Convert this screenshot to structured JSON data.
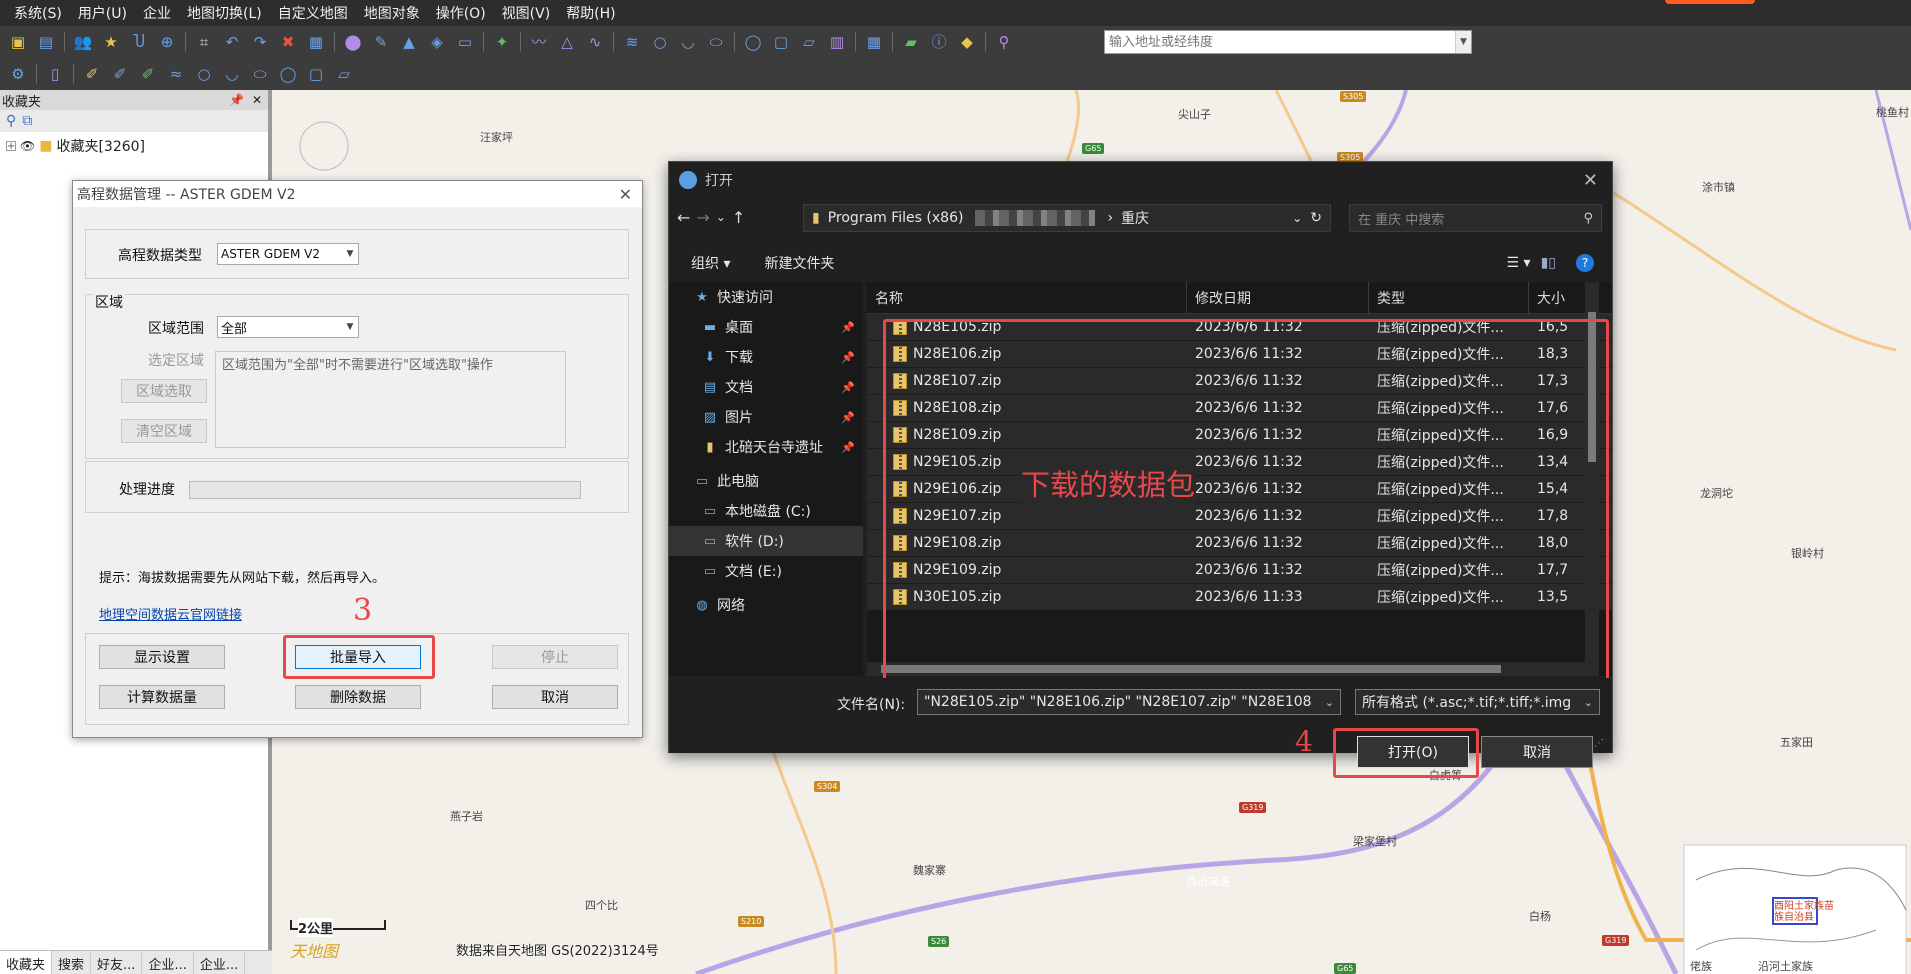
{
  "menu": [
    "系统(S)",
    "用户(U)",
    "企业",
    "地图切换(L)",
    "自定义地图",
    "地图对象",
    "操作(O)",
    "视图(V)",
    "帮助(H)"
  ],
  "toolbar": {
    "search_placeholder": "输入地址或经纬度"
  },
  "left_panel": {
    "title": "收藏夹",
    "tree_label": "收藏夹[3260]",
    "tabs": [
      "收藏夹",
      "搜索",
      "好友...",
      "企业...",
      "企业..."
    ]
  },
  "map": {
    "places": [
      "汪家坪",
      "尖山子",
      "桃鱼村",
      "涂市镇",
      "龙洞坨",
      "银岭村",
      "五家田",
      "白虎箐",
      "梁家堡村",
      "魏家寨",
      "燕子岩",
      "四个比",
      "白杨",
      "佬族",
      "沿河土家族",
      "西沿高速",
      "酉阳土家族苗族自治县"
    ],
    "roads": [
      "G65",
      "S305",
      "S305",
      "S304",
      "G319",
      "S210",
      "S26",
      "G319",
      "G65"
    ],
    "scale": "2公里",
    "logo": "天地图",
    "source": "数据来自天地图 GS(2022)3124号"
  },
  "elevation_dialog": {
    "title": "高程数据管理 -- ASTER GDEM V2",
    "type_label": "高程数据类型",
    "type_value": "ASTER GDEM V2",
    "region_group": "区域",
    "region_range_label": "区域范围",
    "region_range_value": "全部",
    "select_region_label": "选定区域",
    "region_hint": "区域范围为\"全部\"时不需要进行\"区域选取\"操作",
    "select_btn": "区域选取",
    "clear_btn": "清空区域",
    "progress_label": "处理进度",
    "progress": 0,
    "tip": "提示：海拔数据需要先从网站下载，然后再导入。",
    "link": "地理空间数据云官网链接",
    "display_btn": "显示设置",
    "batch_import_btn": "批量导入",
    "stop_btn": "停止",
    "calc_btn": "计算数据量",
    "delete_btn": "删除数据",
    "cancel_btn": "取消",
    "annotation": "3"
  },
  "open_dialog": {
    "title": "打开",
    "path": [
      "Program Files (x86)",
      "重庆"
    ],
    "search_placeholder": "在 重庆 中搜索",
    "organize": "组织 ▾",
    "new_folder": "新建文件夹",
    "sidebar": [
      {
        "label": "快速访问",
        "icon": "★",
        "pin": false,
        "indent": 0
      },
      {
        "label": "桌面",
        "icon": "▬",
        "pin": true,
        "indent": 1
      },
      {
        "label": "下载",
        "icon": "⬇",
        "pin": true,
        "indent": 1
      },
      {
        "label": "文档",
        "icon": "▤",
        "pin": true,
        "indent": 1
      },
      {
        "label": "图片",
        "icon": "▨",
        "pin": true,
        "indent": 1
      },
      {
        "label": "北碚天台寺遗址",
        "icon": "▮",
        "pin": true,
        "indent": 1
      },
      {
        "label": "此电脑",
        "icon": "▭",
        "pin": false,
        "indent": 0
      },
      {
        "label": "本地磁盘 (C:)",
        "icon": "▭",
        "pin": false,
        "indent": 1
      },
      {
        "label": "软件 (D:)",
        "icon": "▭",
        "pin": false,
        "indent": 1
      },
      {
        "label": "文档 (E:)",
        "icon": "▭",
        "pin": false,
        "indent": 1
      },
      {
        "label": "网络",
        "icon": "◍",
        "pin": false,
        "indent": 0
      }
    ],
    "columns": [
      "名称",
      "修改日期",
      "类型",
      "大小"
    ],
    "files": [
      {
        "name": "N28E105.zip",
        "date": "2023/6/6 11:32",
        "type": "压缩(zipped)文件...",
        "size": "16,5"
      },
      {
        "name": "N28E106.zip",
        "date": "2023/6/6 11:32",
        "type": "压缩(zipped)文件...",
        "size": "18,3"
      },
      {
        "name": "N28E107.zip",
        "date": "2023/6/6 11:32",
        "type": "压缩(zipped)文件...",
        "size": "17,3"
      },
      {
        "name": "N28E108.zip",
        "date": "2023/6/6 11:32",
        "type": "压缩(zipped)文件...",
        "size": "17,6"
      },
      {
        "name": "N28E109.zip",
        "date": "2023/6/6 11:32",
        "type": "压缩(zipped)文件...",
        "size": "16,9"
      },
      {
        "name": "N29E105.zip",
        "date": "2023/6/6 11:32",
        "type": "压缩(zipped)文件...",
        "size": "13,4"
      },
      {
        "name": "N29E106.zip",
        "date": "2023/6/6 11:32",
        "type": "压缩(zipped)文件...",
        "size": "15,4"
      },
      {
        "name": "N29E107.zip",
        "date": "2023/6/6 11:32",
        "type": "压缩(zipped)文件...",
        "size": "17,8"
      },
      {
        "name": "N29E108.zip",
        "date": "2023/6/6 11:32",
        "type": "压缩(zipped)文件...",
        "size": "18,0"
      },
      {
        "name": "N29E109.zip",
        "date": "2023/6/6 11:32",
        "type": "压缩(zipped)文件...",
        "size": "17,7"
      },
      {
        "name": "N30E105.zip",
        "date": "2023/6/6 11:33",
        "type": "压缩(zipped)文件...",
        "size": "13,5"
      }
    ],
    "annotation_label": "下载的数据包",
    "filename_label": "文件名(N):",
    "filename_value": "\"N28E105.zip\" \"N28E106.zip\" \"N28E107.zip\" \"N28E108",
    "filetype_value": "所有格式 (*.asc;*.tif;*.tiff;*.img",
    "open_btn": "打开(O)",
    "cancel_btn": "取消",
    "annotation": "4"
  },
  "colors": {
    "annotation_red": "#e8474c",
    "menubar": "#2d2d2d",
    "toolbar": "#3c3c3c",
    "dialog_dark": "#202020"
  }
}
